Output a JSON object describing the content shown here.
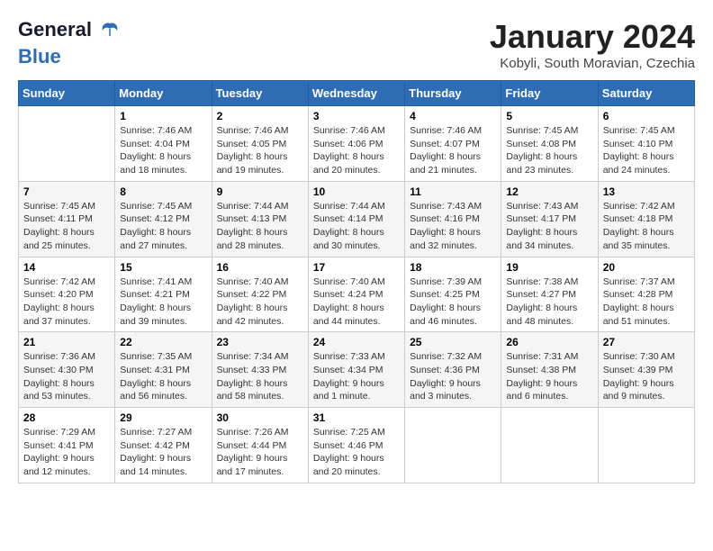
{
  "logo": {
    "part1": "General",
    "part2": "Blue"
  },
  "title": "January 2024",
  "subtitle": "Kobyli, South Moravian, Czechia",
  "days_of_week": [
    "Sunday",
    "Monday",
    "Tuesday",
    "Wednesday",
    "Thursday",
    "Friday",
    "Saturday"
  ],
  "weeks": [
    [
      {
        "day": "",
        "info": ""
      },
      {
        "day": "1",
        "info": "Sunrise: 7:46 AM\nSunset: 4:04 PM\nDaylight: 8 hours\nand 18 minutes."
      },
      {
        "day": "2",
        "info": "Sunrise: 7:46 AM\nSunset: 4:05 PM\nDaylight: 8 hours\nand 19 minutes."
      },
      {
        "day": "3",
        "info": "Sunrise: 7:46 AM\nSunset: 4:06 PM\nDaylight: 8 hours\nand 20 minutes."
      },
      {
        "day": "4",
        "info": "Sunrise: 7:46 AM\nSunset: 4:07 PM\nDaylight: 8 hours\nand 21 minutes."
      },
      {
        "day": "5",
        "info": "Sunrise: 7:45 AM\nSunset: 4:08 PM\nDaylight: 8 hours\nand 23 minutes."
      },
      {
        "day": "6",
        "info": "Sunrise: 7:45 AM\nSunset: 4:10 PM\nDaylight: 8 hours\nand 24 minutes."
      }
    ],
    [
      {
        "day": "7",
        "info": "Sunrise: 7:45 AM\nSunset: 4:11 PM\nDaylight: 8 hours\nand 25 minutes."
      },
      {
        "day": "8",
        "info": "Sunrise: 7:45 AM\nSunset: 4:12 PM\nDaylight: 8 hours\nand 27 minutes."
      },
      {
        "day": "9",
        "info": "Sunrise: 7:44 AM\nSunset: 4:13 PM\nDaylight: 8 hours\nand 28 minutes."
      },
      {
        "day": "10",
        "info": "Sunrise: 7:44 AM\nSunset: 4:14 PM\nDaylight: 8 hours\nand 30 minutes."
      },
      {
        "day": "11",
        "info": "Sunrise: 7:43 AM\nSunset: 4:16 PM\nDaylight: 8 hours\nand 32 minutes."
      },
      {
        "day": "12",
        "info": "Sunrise: 7:43 AM\nSunset: 4:17 PM\nDaylight: 8 hours\nand 34 minutes."
      },
      {
        "day": "13",
        "info": "Sunrise: 7:42 AM\nSunset: 4:18 PM\nDaylight: 8 hours\nand 35 minutes."
      }
    ],
    [
      {
        "day": "14",
        "info": "Sunrise: 7:42 AM\nSunset: 4:20 PM\nDaylight: 8 hours\nand 37 minutes."
      },
      {
        "day": "15",
        "info": "Sunrise: 7:41 AM\nSunset: 4:21 PM\nDaylight: 8 hours\nand 39 minutes."
      },
      {
        "day": "16",
        "info": "Sunrise: 7:40 AM\nSunset: 4:22 PM\nDaylight: 8 hours\nand 42 minutes."
      },
      {
        "day": "17",
        "info": "Sunrise: 7:40 AM\nSunset: 4:24 PM\nDaylight: 8 hours\nand 44 minutes."
      },
      {
        "day": "18",
        "info": "Sunrise: 7:39 AM\nSunset: 4:25 PM\nDaylight: 8 hours\nand 46 minutes."
      },
      {
        "day": "19",
        "info": "Sunrise: 7:38 AM\nSunset: 4:27 PM\nDaylight: 8 hours\nand 48 minutes."
      },
      {
        "day": "20",
        "info": "Sunrise: 7:37 AM\nSunset: 4:28 PM\nDaylight: 8 hours\nand 51 minutes."
      }
    ],
    [
      {
        "day": "21",
        "info": "Sunrise: 7:36 AM\nSunset: 4:30 PM\nDaylight: 8 hours\nand 53 minutes."
      },
      {
        "day": "22",
        "info": "Sunrise: 7:35 AM\nSunset: 4:31 PM\nDaylight: 8 hours\nand 56 minutes."
      },
      {
        "day": "23",
        "info": "Sunrise: 7:34 AM\nSunset: 4:33 PM\nDaylight: 8 hours\nand 58 minutes."
      },
      {
        "day": "24",
        "info": "Sunrise: 7:33 AM\nSunset: 4:34 PM\nDaylight: 9 hours\nand 1 minute."
      },
      {
        "day": "25",
        "info": "Sunrise: 7:32 AM\nSunset: 4:36 PM\nDaylight: 9 hours\nand 3 minutes."
      },
      {
        "day": "26",
        "info": "Sunrise: 7:31 AM\nSunset: 4:38 PM\nDaylight: 9 hours\nand 6 minutes."
      },
      {
        "day": "27",
        "info": "Sunrise: 7:30 AM\nSunset: 4:39 PM\nDaylight: 9 hours\nand 9 minutes."
      }
    ],
    [
      {
        "day": "28",
        "info": "Sunrise: 7:29 AM\nSunset: 4:41 PM\nDaylight: 9 hours\nand 12 minutes."
      },
      {
        "day": "29",
        "info": "Sunrise: 7:27 AM\nSunset: 4:42 PM\nDaylight: 9 hours\nand 14 minutes."
      },
      {
        "day": "30",
        "info": "Sunrise: 7:26 AM\nSunset: 4:44 PM\nDaylight: 9 hours\nand 17 minutes."
      },
      {
        "day": "31",
        "info": "Sunrise: 7:25 AM\nSunset: 4:46 PM\nDaylight: 9 hours\nand 20 minutes."
      },
      {
        "day": "",
        "info": ""
      },
      {
        "day": "",
        "info": ""
      },
      {
        "day": "",
        "info": ""
      }
    ]
  ]
}
